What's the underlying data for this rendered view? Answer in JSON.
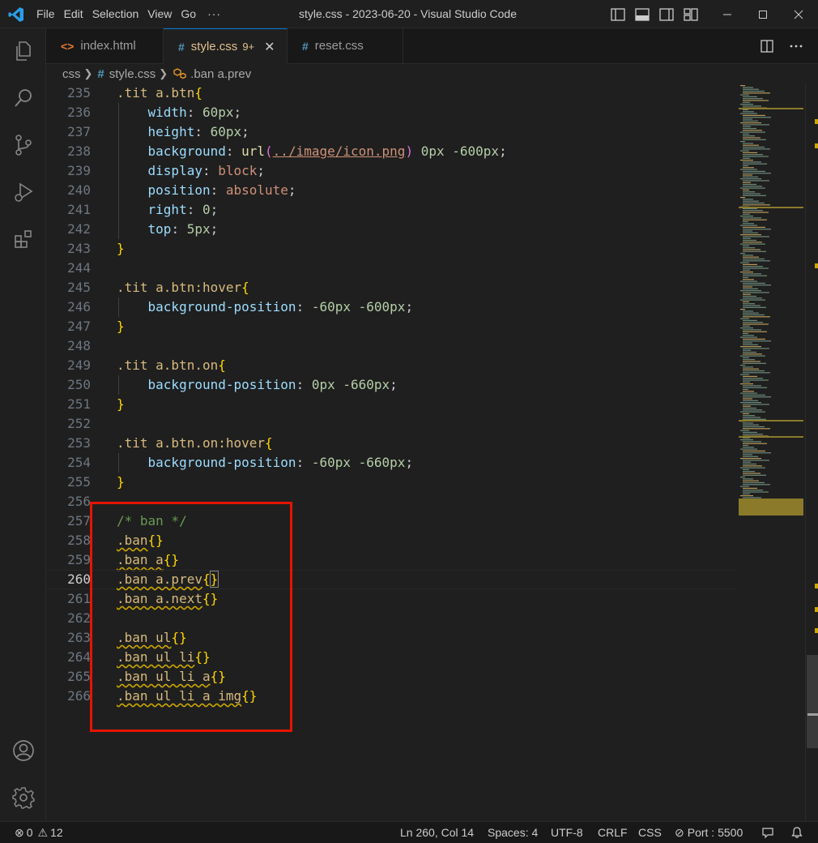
{
  "titlebar": {
    "menu": [
      "File",
      "Edit",
      "Selection",
      "View",
      "Go"
    ],
    "more": "···",
    "title": "style.css - 2023-06-20 - Visual Studio Code"
  },
  "tabs": [
    {
      "label": "index.html",
      "icon": "html-file-icon",
      "icon_glyph": "<>",
      "icon_color": "#e37933"
    },
    {
      "label": "style.css",
      "icon": "css-file-icon",
      "icon_glyph": "#",
      "icon_color": "#519aba",
      "badge": "9+",
      "active": true
    },
    {
      "label": "reset.css",
      "icon": "css-file-icon",
      "icon_glyph": "#",
      "icon_color": "#519aba"
    }
  ],
  "breadcrumb": {
    "folder": "css",
    "file": "style.css",
    "symbol": ".ban a.prev"
  },
  "code_lines": [
    {
      "n": "235",
      "segs": [
        [
          "sel",
          ".tit a.btn"
        ],
        [
          "br",
          "{"
        ]
      ]
    },
    {
      "n": "236",
      "guide": true,
      "segs": [
        [
          "pun",
          "    "
        ],
        [
          "prop",
          "width"
        ],
        [
          "pun",
          ": "
        ],
        [
          "num",
          "60px"
        ],
        [
          "pun",
          ";"
        ]
      ]
    },
    {
      "n": "237",
      "guide": true,
      "segs": [
        [
          "pun",
          "    "
        ],
        [
          "prop",
          "height"
        ],
        [
          "pun",
          ": "
        ],
        [
          "num",
          "60px"
        ],
        [
          "pun",
          ";"
        ]
      ]
    },
    {
      "n": "238",
      "guide": true,
      "segs": [
        [
          "pun",
          "    "
        ],
        [
          "prop",
          "background"
        ],
        [
          "pun",
          ": "
        ],
        [
          "fn",
          "url"
        ],
        [
          "paren",
          "("
        ],
        [
          "url",
          "../image/icon.png"
        ],
        [
          "paren",
          ")"
        ],
        [
          "pun",
          " "
        ],
        [
          "num",
          "0px"
        ],
        [
          "pun",
          " "
        ],
        [
          "num",
          "-600px"
        ],
        [
          "pun",
          ";"
        ]
      ]
    },
    {
      "n": "239",
      "guide": true,
      "segs": [
        [
          "pun",
          "    "
        ],
        [
          "prop",
          "display"
        ],
        [
          "pun",
          ": "
        ],
        [
          "val",
          "block"
        ],
        [
          "pun",
          ";"
        ]
      ]
    },
    {
      "n": "240",
      "guide": true,
      "segs": [
        [
          "pun",
          "    "
        ],
        [
          "prop",
          "position"
        ],
        [
          "pun",
          ": "
        ],
        [
          "val",
          "absolute"
        ],
        [
          "pun",
          ";"
        ]
      ]
    },
    {
      "n": "241",
      "guide": true,
      "segs": [
        [
          "pun",
          "    "
        ],
        [
          "prop",
          "right"
        ],
        [
          "pun",
          ": "
        ],
        [
          "num",
          "0"
        ],
        [
          "pun",
          ";"
        ]
      ]
    },
    {
      "n": "242",
      "guide": true,
      "segs": [
        [
          "pun",
          "    "
        ],
        [
          "prop",
          "top"
        ],
        [
          "pun",
          ": "
        ],
        [
          "num",
          "5px"
        ],
        [
          "pun",
          ";"
        ]
      ]
    },
    {
      "n": "243",
      "segs": [
        [
          "br",
          "}"
        ]
      ]
    },
    {
      "n": "244",
      "segs": []
    },
    {
      "n": "245",
      "segs": [
        [
          "sel",
          ".tit a.btn:hover"
        ],
        [
          "br",
          "{"
        ]
      ]
    },
    {
      "n": "246",
      "guide": true,
      "segs": [
        [
          "pun",
          "    "
        ],
        [
          "prop",
          "background-position"
        ],
        [
          "pun",
          ": "
        ],
        [
          "num",
          "-60px"
        ],
        [
          "pun",
          " "
        ],
        [
          "num",
          "-600px"
        ],
        [
          "pun",
          ";"
        ]
      ]
    },
    {
      "n": "247",
      "segs": [
        [
          "br",
          "}"
        ]
      ]
    },
    {
      "n": "248",
      "segs": []
    },
    {
      "n": "249",
      "segs": [
        [
          "sel",
          ".tit a.btn.on"
        ],
        [
          "br",
          "{"
        ]
      ]
    },
    {
      "n": "250",
      "guide": true,
      "segs": [
        [
          "pun",
          "    "
        ],
        [
          "prop",
          "background-position"
        ],
        [
          "pun",
          ": "
        ],
        [
          "num",
          "0px"
        ],
        [
          "pun",
          " "
        ],
        [
          "num",
          "-660px"
        ],
        [
          "pun",
          ";"
        ]
      ]
    },
    {
      "n": "251",
      "segs": [
        [
          "br",
          "}"
        ]
      ]
    },
    {
      "n": "252",
      "segs": []
    },
    {
      "n": "253",
      "segs": [
        [
          "sel",
          ".tit a.btn.on:hover"
        ],
        [
          "br",
          "{"
        ]
      ]
    },
    {
      "n": "254",
      "guide": true,
      "segs": [
        [
          "pun",
          "    "
        ],
        [
          "prop",
          "background-position"
        ],
        [
          "pun",
          ": "
        ],
        [
          "num",
          "-60px"
        ],
        [
          "pun",
          " "
        ],
        [
          "num",
          "-660px"
        ],
        [
          "pun",
          ";"
        ]
      ]
    },
    {
      "n": "255",
      "segs": [
        [
          "br",
          "}"
        ]
      ]
    },
    {
      "n": "256",
      "segs": []
    },
    {
      "n": "257",
      "segs": [
        [
          "cmt",
          "/* ban */"
        ]
      ]
    },
    {
      "n": "258",
      "segs": [
        [
          "sel warn",
          ".ban"
        ],
        [
          "br",
          "{}"
        ]
      ]
    },
    {
      "n": "259",
      "segs": [
        [
          "sel warn",
          ".ban a"
        ],
        [
          "br",
          "{}"
        ]
      ]
    },
    {
      "n": "260",
      "current": true,
      "segs": [
        [
          "sel warn",
          ".ban a.prev"
        ],
        [
          "br",
          "{"
        ],
        [
          "br cursor-box",
          "}"
        ]
      ]
    },
    {
      "n": "261",
      "segs": [
        [
          "sel warn",
          ".ban a.next"
        ],
        [
          "br",
          "{}"
        ]
      ]
    },
    {
      "n": "262",
      "segs": []
    },
    {
      "n": "263",
      "segs": [
        [
          "sel warn",
          ".ban ul"
        ],
        [
          "br",
          "{}"
        ]
      ]
    },
    {
      "n": "264",
      "segs": [
        [
          "sel warn",
          ".ban ul li"
        ],
        [
          "br",
          "{}"
        ]
      ]
    },
    {
      "n": "265",
      "segs": [
        [
          "sel warn",
          ".ban ul li a"
        ],
        [
          "br",
          "{}"
        ]
      ]
    },
    {
      "n": "266",
      "segs": [
        [
          "sel warn",
          ".ban ul li a img"
        ],
        [
          "br",
          "{}"
        ]
      ]
    }
  ],
  "statusbar": {
    "errors": "0",
    "warnings": "12",
    "position": "Ln 260, Col 14",
    "spaces": "Spaces: 4",
    "encoding": "UTF-8",
    "eol": "CRLF",
    "language": "CSS",
    "port": "Port : 5500"
  },
  "colors": {
    "accent": "#0078d4",
    "warning": "#cca700",
    "highlight_box": "#e51400"
  }
}
